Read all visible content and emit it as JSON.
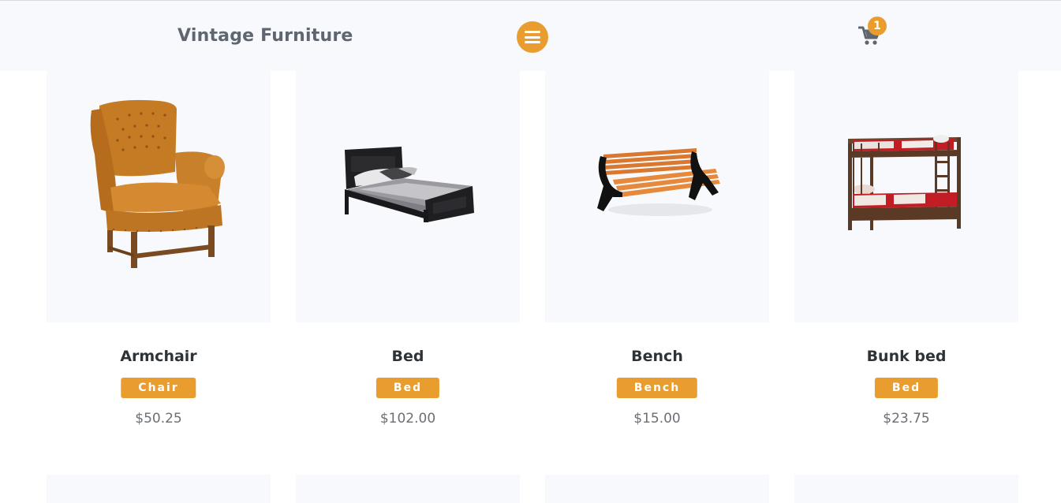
{
  "header": {
    "brand": "Vintage Furniture",
    "cart_count": "1"
  },
  "colors": {
    "accent": "#e99d2e",
    "header_bg": "#f8f9fc",
    "card_bg": "#f8f9fc",
    "title_text": "#2e3338",
    "price_text": "#6a6f76"
  },
  "icons": {
    "menu": "hamburger-menu-icon",
    "cart": "shopping-cart-icon"
  },
  "products": [
    {
      "name": "Armchair",
      "category": "Chair",
      "price": "$50.25",
      "image": "armchair-image"
    },
    {
      "name": "Bed",
      "category": "Bed",
      "price": "$102.00",
      "image": "bed-image"
    },
    {
      "name": "Bench",
      "category": "Bench",
      "price": "$15.00",
      "image": "bench-image"
    },
    {
      "name": "Bunk bed",
      "category": "Bed",
      "price": "$23.75",
      "image": "bunk-bed-image"
    }
  ]
}
